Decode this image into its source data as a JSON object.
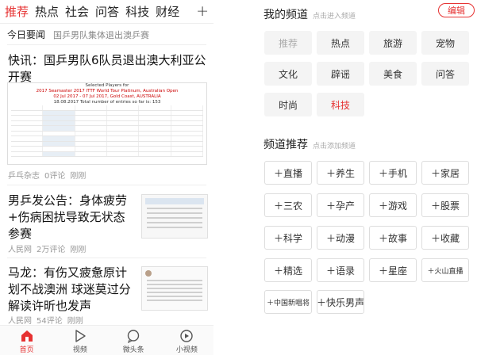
{
  "tabs": [
    "推荐",
    "热点",
    "社会",
    "问答",
    "科技",
    "财经"
  ],
  "tabs_plus": "+",
  "today": {
    "title": "今日要闻",
    "headline": "国乒男队集体退出澳乒赛"
  },
  "news": [
    {
      "title": "快讯：国乒男队6队员退出澳大利亚公开赛",
      "source": "乒乓杂志",
      "comments": "0评论",
      "time": "刚刚"
    },
    {
      "title": "男乒发公告：身体疲劳+伤病困扰导致无状态参赛",
      "source": "人民网",
      "comments": "2万评论",
      "time": "刚刚"
    },
    {
      "title": "马龙：有伤又疲惫原计划不战澳洲 球迷莫过分解读许昕也发声",
      "source": "人民网",
      "comments": "54评论",
      "time": "刚刚"
    }
  ],
  "image1": {
    "line1": "Selected Players for",
    "line2": "2017 Seamaster 2017 ITTF World Tour Platinum, Australian Open",
    "line3": "02 Jul 2017 - 07 Jul 2017, Gold Coast, AUSTRALIA",
    "line4": "18.08.2017     Total number of entries so far is: 153"
  },
  "bottom_nav": [
    {
      "label": "首页",
      "icon": "home-icon"
    },
    {
      "label": "视频",
      "icon": "play-icon"
    },
    {
      "label": "微头条",
      "icon": "chat-icon"
    },
    {
      "label": "小视频",
      "icon": "small-video-icon"
    }
  ],
  "my_channels": {
    "title": "我的频道",
    "subtitle": "点击进入频道",
    "edit": "编辑",
    "items": [
      "推荐",
      "热点",
      "旅游",
      "宠物",
      "文化",
      "辟谣",
      "美食",
      "问答",
      "时尚",
      "科技"
    ]
  },
  "recommend": {
    "title": "频道推荐",
    "subtitle": "点击添加频道",
    "items": [
      "＋直播",
      "＋养生",
      "＋手机",
      "＋家居",
      "＋三农",
      "＋孕产",
      "＋游戏",
      "＋股票",
      "＋科学",
      "＋动漫",
      "＋故事",
      "＋收藏",
      "＋精选",
      "＋语录",
      "＋星座",
      "＋火山直播",
      "＋中国新唱将",
      "＋快乐男声"
    ]
  },
  "colors": {
    "accent": "#e63232",
    "chip_bg": "#f4f4f4"
  }
}
